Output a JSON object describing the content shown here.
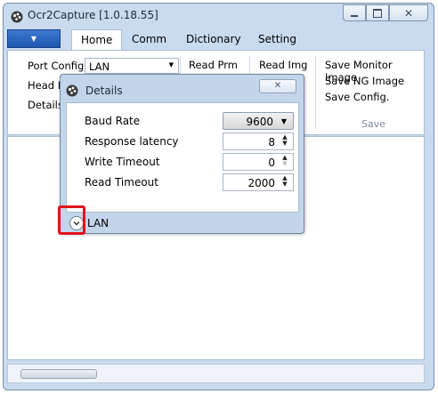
{
  "window": {
    "title": "Ocr2Capture [1.0.18.55]"
  },
  "ribbon": {
    "tabs": [
      "Home",
      "Comm",
      "Dictionary",
      "Setting"
    ],
    "port_config_label": "Port Config",
    "port_config_value": "LAN",
    "head_label": "Head N",
    "details_label": "Details",
    "read_prm": "Read Prm",
    "read_img": "Read Img",
    "save_monitor_image": "Save Monitor Image",
    "save_ng_image": "Save NG Image",
    "save_config": "Save Config.",
    "save_group_label": "Save"
  },
  "dialog": {
    "title": "Details",
    "fields": [
      {
        "label": "Baud Rate",
        "value": "9600"
      },
      {
        "label": "Response latency",
        "value": "8"
      },
      {
        "label": "Write Timeout",
        "value": "0"
      },
      {
        "label": "Read Timeout",
        "value": "2000"
      }
    ],
    "expander_label": "LAN"
  },
  "icons": [
    "app-icon",
    "minimize-icon",
    "maximize-icon",
    "close-icon",
    "dropdown-arrow-icon",
    "spin-up-icon",
    "spin-down-icon",
    "expand-chevron-icon"
  ],
  "colors": {
    "highlight": "#e0141c",
    "appbtn": "#2a66c1",
    "frame": "#c9dbef"
  }
}
